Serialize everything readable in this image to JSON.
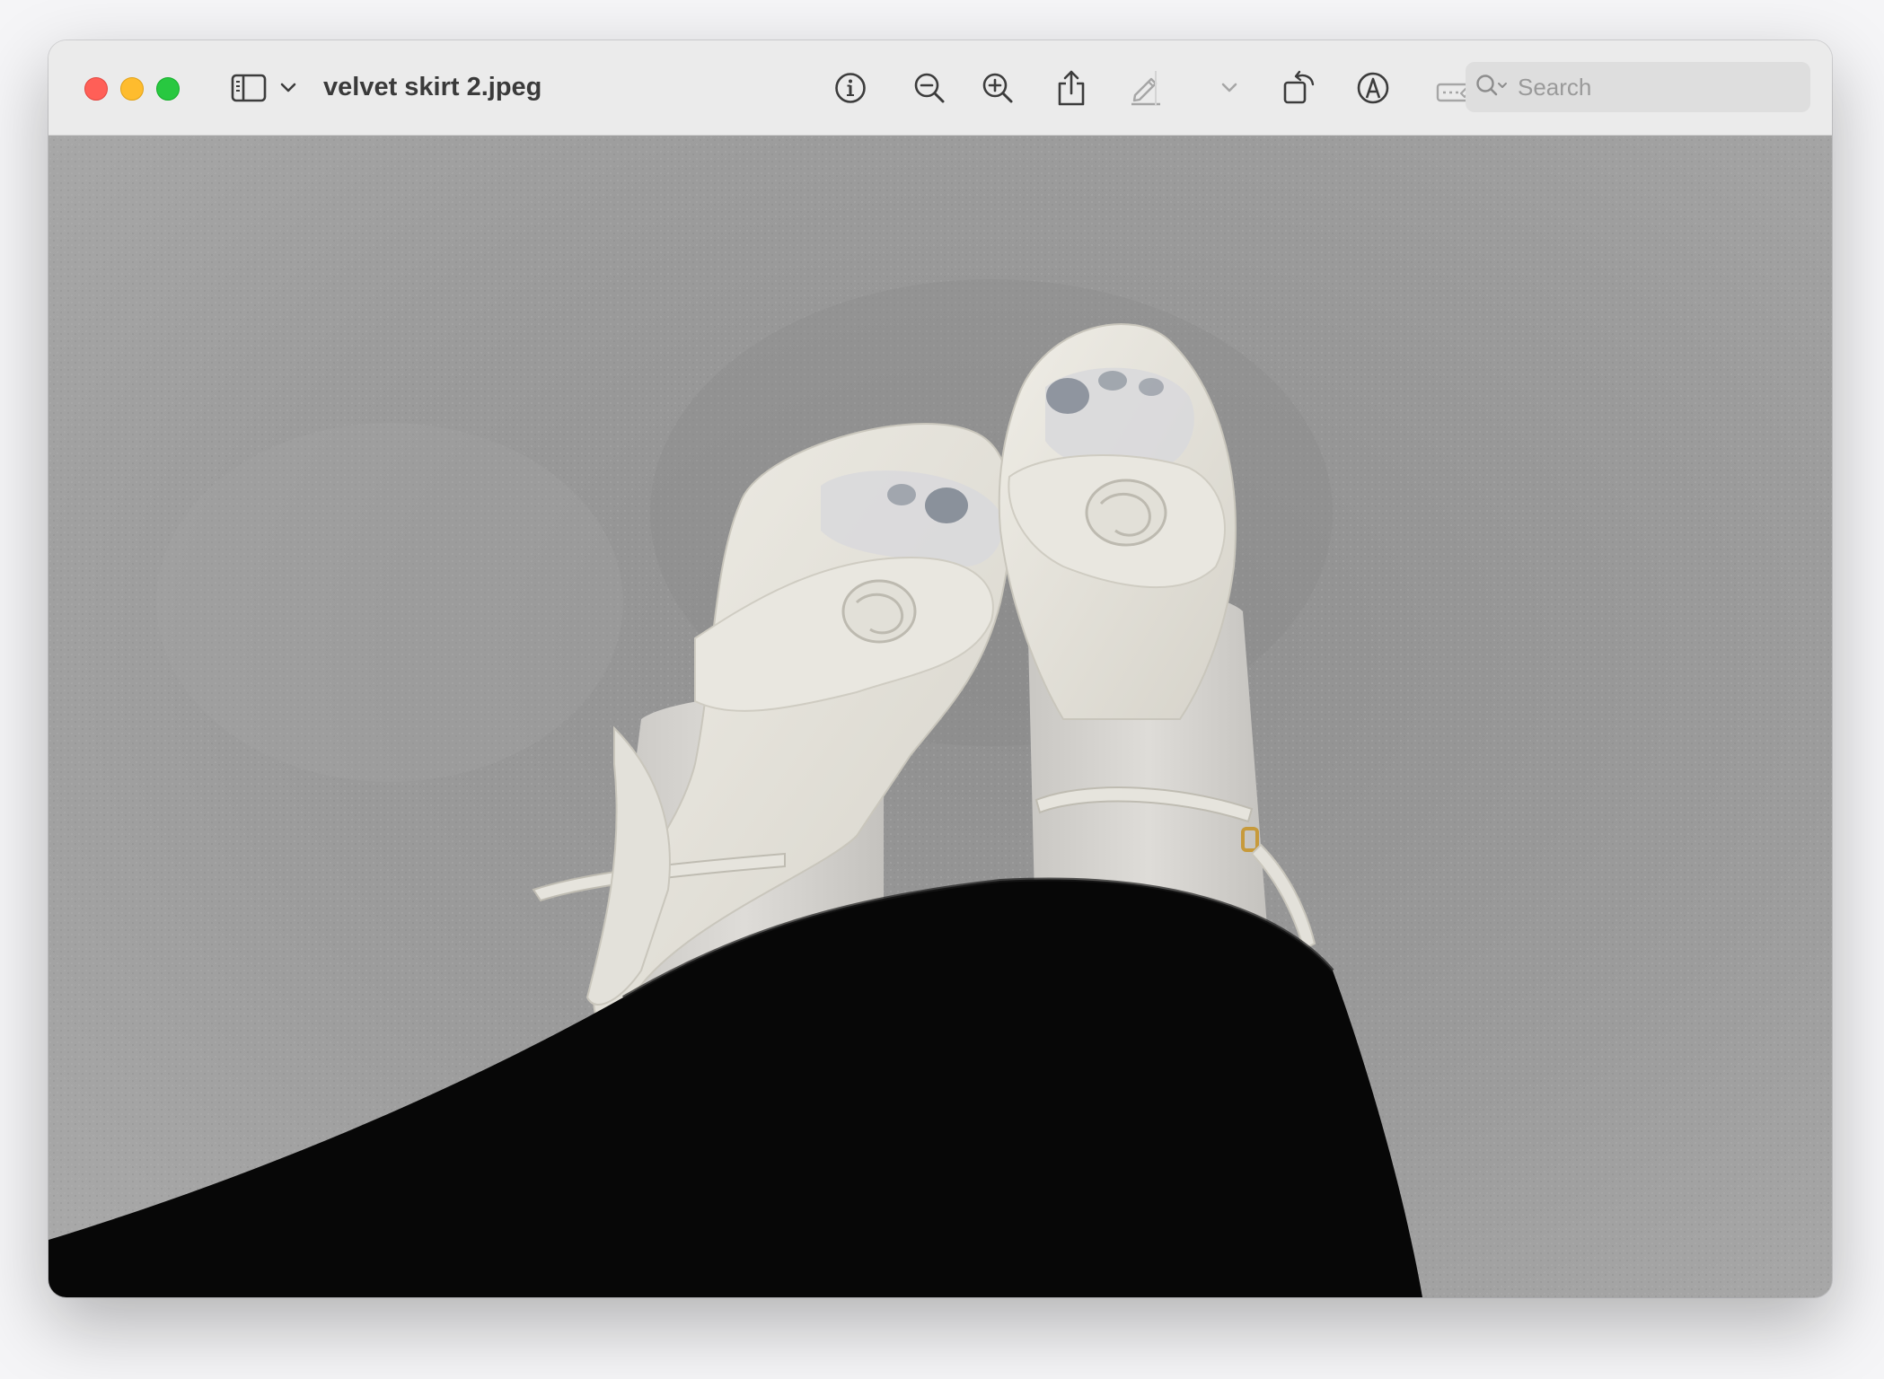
{
  "window": {
    "title": "velvet skirt 2.jpeg"
  },
  "toolbar": {
    "items": [
      {
        "name": "sidebar-toggle",
        "icon": "sidebar-icon"
      },
      {
        "name": "sidebar-menu",
        "icon": "chevron-down-icon"
      },
      {
        "name": "info",
        "icon": "info-icon"
      },
      {
        "name": "zoom-out",
        "icon": "zoom-out-icon"
      },
      {
        "name": "zoom-in",
        "icon": "zoom-in-icon"
      },
      {
        "name": "share",
        "icon": "share-icon"
      },
      {
        "name": "markup",
        "icon": "pencil-icon"
      },
      {
        "name": "markup-menu",
        "icon": "chevron-down-icon"
      },
      {
        "name": "rotate",
        "icon": "rotate-icon"
      },
      {
        "name": "annotate",
        "icon": "markup-pen-circle-icon"
      },
      {
        "name": "signature",
        "icon": "signature-icon"
      }
    ],
    "colors": {
      "icon": "#3c3c3c",
      "icon_disabled": "#a6a6a6"
    }
  },
  "search": {
    "placeholder": "Search"
  },
  "image": {
    "description_icon": "photo-content",
    "colors": {
      "carpet": "#9e9e9e",
      "shoe": "#e6e4dc",
      "skirt": "#070707"
    }
  }
}
